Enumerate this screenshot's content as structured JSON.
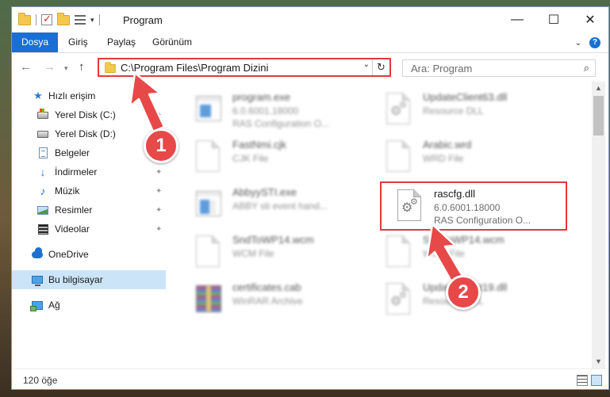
{
  "window": {
    "title": "Program",
    "controls": {
      "minimize": "—",
      "maximize": "☐",
      "close": "✕"
    }
  },
  "ribbon": {
    "tabs": [
      "Dosya",
      "Giriş",
      "Paylaş",
      "Görünüm"
    ],
    "active_tab": "Dosya",
    "accent_color": "#1a6fd4"
  },
  "address_bar": {
    "path": "C:\\Program Files\\Program Dizini",
    "search_placeholder": "Ara: Program"
  },
  "nav_pane": {
    "items": [
      {
        "label": "Hızlı erişim",
        "icon": "star-icon"
      },
      {
        "label": "Yerel Disk (C:)",
        "icon": "os-drive-icon",
        "pinned": true
      },
      {
        "label": "Yerel Disk (D:)",
        "icon": "drive-icon"
      },
      {
        "label": "Belgeler",
        "icon": "documents-icon",
        "pinned": true
      },
      {
        "label": "İndirmeler",
        "icon": "download-icon",
        "pinned": true
      },
      {
        "label": "Müzik",
        "icon": "music-icon",
        "pinned": true
      },
      {
        "label": "Resimler",
        "icon": "pictures-icon",
        "pinned": true
      },
      {
        "label": "Videolar",
        "icon": "videos-icon",
        "pinned": true
      },
      {
        "label": "OneDrive",
        "icon": "onedrive-icon"
      },
      {
        "label": "Bu bilgisayar",
        "icon": "this-pc-icon",
        "selected": true
      },
      {
        "label": "Ağ",
        "icon": "network-icon"
      }
    ]
  },
  "files": [
    {
      "name": "program.exe",
      "line1": "6.0.6001.18000",
      "line2": "RAS Configuration O...",
      "icon": "exe-icon",
      "blurred": true
    },
    {
      "name": "UpdateClient63.dll",
      "line1": "Resource DLL",
      "line2": "",
      "icon": "dll-icon",
      "blurred": true
    },
    {
      "name": "FastNmi.cjk",
      "line1": "CJK File",
      "line2": "",
      "icon": "generic-file-icon",
      "blurred": true
    },
    {
      "name": "Arabic.wrd",
      "line1": "WRD File",
      "line2": "",
      "icon": "generic-file-icon",
      "blurred": true
    },
    {
      "name": "AbbyySTI.exe",
      "line1": "ABBY sti event hand...",
      "line2": "",
      "icon": "app-icon",
      "blurred": true
    },
    {
      "name": "rascfg.dll",
      "line1": "6.0.6001.18000",
      "line2": "RAS Configuration O...",
      "icon": "dll-icon",
      "blurred": false,
      "highlighted": true
    },
    {
      "name": "SndToWP14.wcm",
      "line1": "WCM File",
      "line2": "",
      "icon": "generic-file-icon",
      "blurred": true
    },
    {
      "name": "SndToWP14.wcm",
      "line1": "WCM File",
      "line2": "",
      "icon": "generic-file-icon",
      "blurred": true
    },
    {
      "name": "certificates.cab",
      "line1": "WinRAR Archive",
      "line2": "",
      "icon": "winrar-icon",
      "blurred": true
    },
    {
      "name": "UpdateClient19.dll",
      "line1": "Resource DLL",
      "line2": "",
      "icon": "dll-icon",
      "blurred": true
    }
  ],
  "status_bar": {
    "item_count": "120 öğe"
  },
  "annotations": {
    "step1": "1",
    "step2": "2",
    "color": "#e74848"
  }
}
